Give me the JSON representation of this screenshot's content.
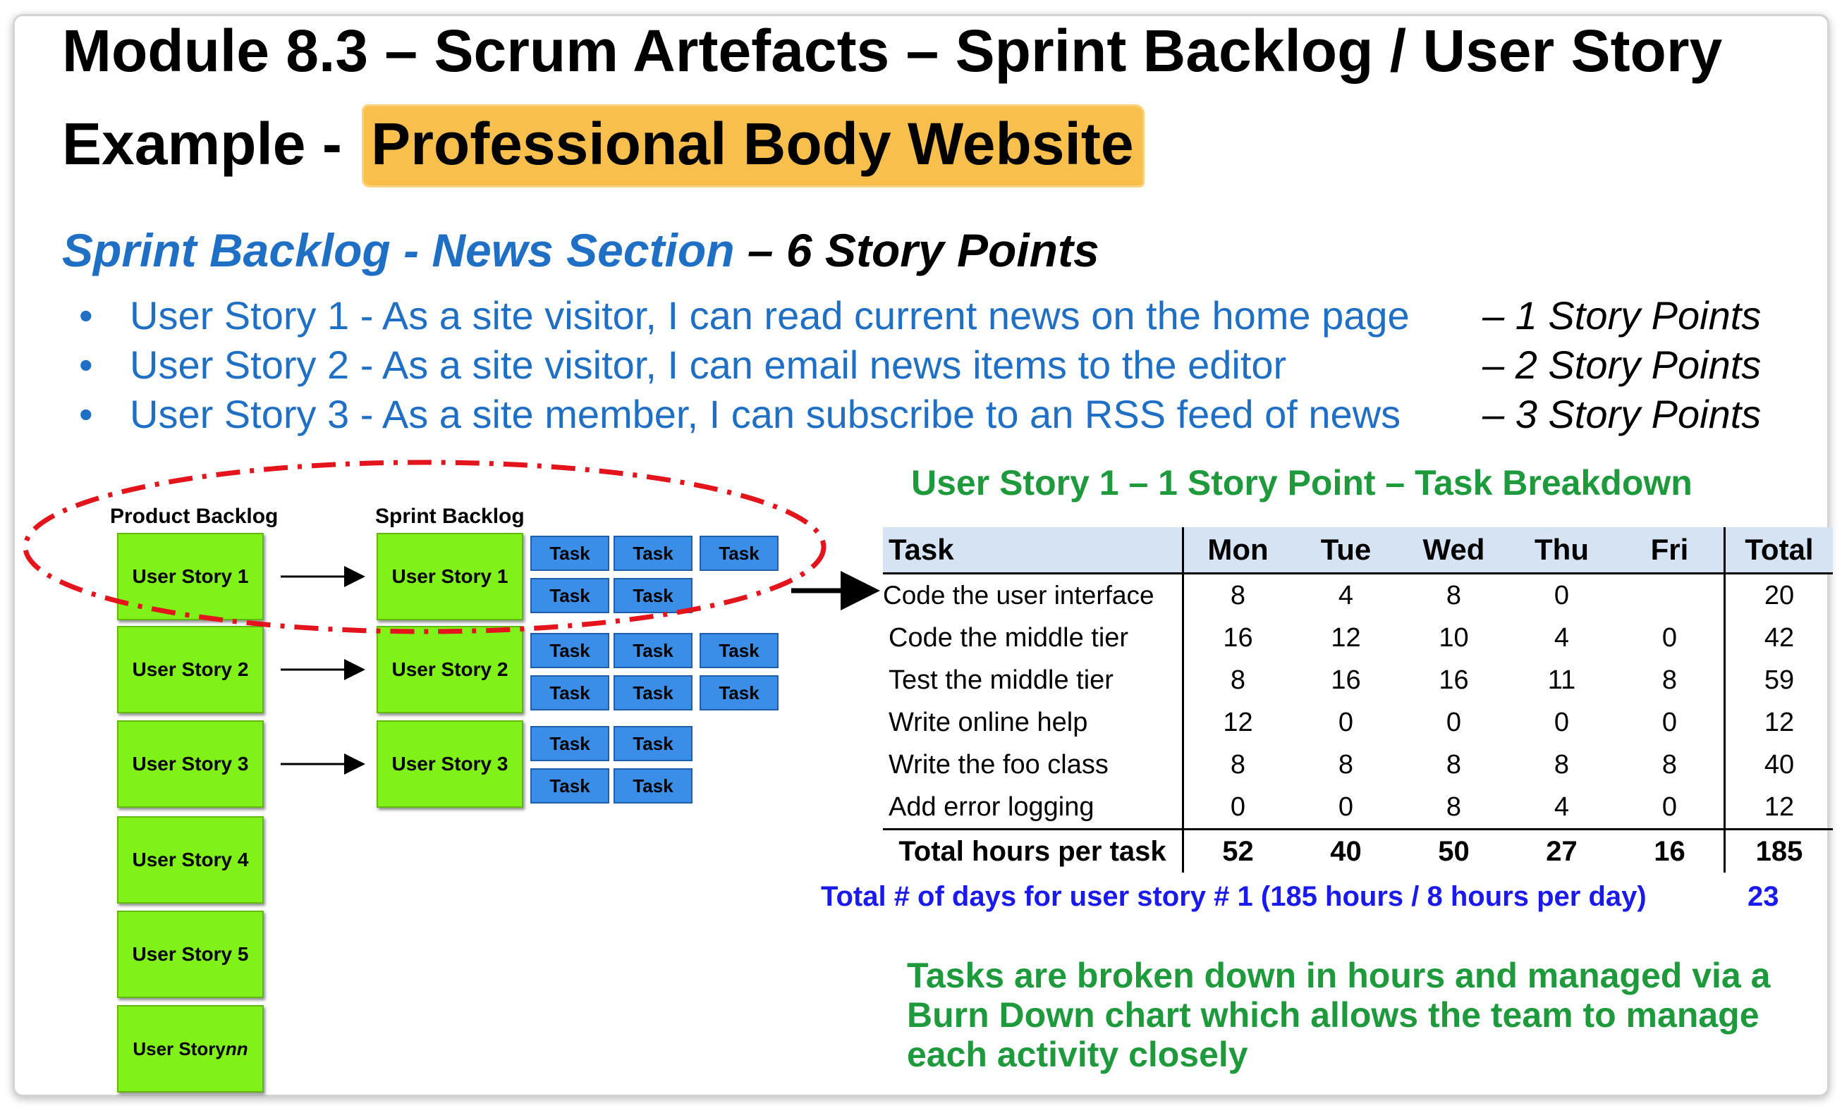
{
  "title": {
    "line1": "Module 8.3 – Scrum Artefacts – Sprint Backlog / User Story",
    "line2_prefix": "Example - ",
    "line2_highlight": "Professional Body Website"
  },
  "sprint_backlog_heading": {
    "blue_part": "Sprint Backlog - News Section",
    "black_part": "– 6 Story Points"
  },
  "user_stories": [
    {
      "text": "User Story 1 - As a site visitor, I can read current news on the home page",
      "points": "– 1 Story Points"
    },
    {
      "text": "User Story 2 - As a site visitor, I can email news items to the editor",
      "points": "– 2 Story Points"
    },
    {
      "text": "User Story 3 - As a site member, I can subscribe to an RSS feed of news",
      "points": "– 3 Story Points"
    }
  ],
  "diagram": {
    "product_backlog_label": "Product Backlog",
    "sprint_backlog_label": "Sprint Backlog",
    "product_items": [
      "User Story 1",
      "User Story 2",
      "User Story 3",
      "User Story 4",
      "User Story 5",
      "User Story nn"
    ],
    "sprint_items": [
      "User Story 1",
      "User Story 2",
      "User Story 3"
    ],
    "task_label": "Task",
    "colors": {
      "sticky": "#80f21a",
      "task": "#3a8ee8",
      "ellipse": "#e3141b"
    }
  },
  "breakdown_title": "User Story 1 – 1 Story Point – Task Breakdown",
  "table": {
    "headers": [
      "Task",
      "Mon",
      "Tue",
      "Wed",
      "Thu",
      "Fri",
      "Total"
    ],
    "rows": [
      {
        "task": "Code the user interface",
        "values": [
          "8",
          "4",
          "8",
          "0",
          "",
          "20"
        ]
      },
      {
        "task": "Code the middle tier",
        "values": [
          "16",
          "12",
          "10",
          "4",
          "0",
          "42"
        ]
      },
      {
        "task": "Test the middle tier",
        "values": [
          "8",
          "16",
          "16",
          "11",
          "8",
          "59"
        ]
      },
      {
        "task": "Write online help",
        "values": [
          "12",
          "0",
          "0",
          "0",
          "0",
          "12"
        ]
      },
      {
        "task": "Write the foo class",
        "values": [
          "8",
          "8",
          "8",
          "8",
          "8",
          "40"
        ]
      },
      {
        "task": "Add error logging",
        "values": [
          "0",
          "0",
          "8",
          "4",
          "0",
          "12"
        ]
      }
    ],
    "total_row": {
      "label": "Total hours per task",
      "values": [
        "52",
        "40",
        "50",
        "27",
        "16",
        "185"
      ]
    }
  },
  "days_summary": {
    "text": "Total # of days for user story # 1 (185 hours / 8 hours per day)",
    "value": "23"
  },
  "note": "Tasks are broken down in hours and managed via a Burn Down chart which allows the team to manage each activity closely"
}
